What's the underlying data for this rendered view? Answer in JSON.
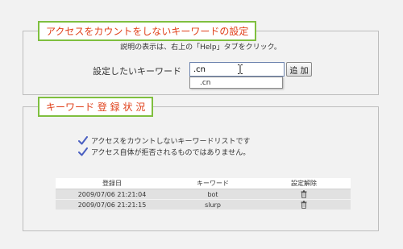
{
  "settings_panel": {
    "title": "アクセスをカウントをしないキーワードの設定",
    "help_text": "説明の表示は、右上の「Help」タブをクリック。",
    "keyword_label": "設定したいキーワード",
    "keyword_value": ".cn",
    "add_button": "追 加",
    "suggestion": ".cn"
  },
  "status_panel": {
    "title": "キーワード 登 録 状 況",
    "notes": [
      "アクセスをカウントしないキーワードリストです",
      "アクセス自体が拒否されるものではありません。"
    ],
    "table": {
      "headers": [
        "登録日",
        "キーワード",
        "設定解除"
      ],
      "rows": [
        {
          "date": "2009/07/06 21:21:04",
          "keyword": "bot"
        },
        {
          "date": "2009/07/06 21:21:15",
          "keyword": "slurp"
        }
      ]
    }
  },
  "colors": {
    "title_text": "#e0401a",
    "title_border": "#7fbf3f",
    "check": "#4a5fc1"
  }
}
